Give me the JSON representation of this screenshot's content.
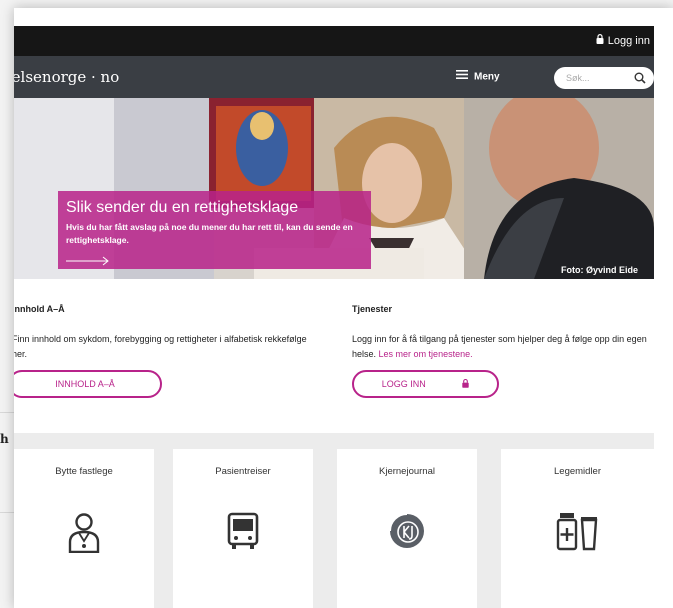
{
  "outside_fragment": "h",
  "topbar": {
    "login_label": "Logg inn"
  },
  "navbar": {
    "logo": "helsenorge · no",
    "menu_label": "Meny",
    "search_placeholder": "Søk..."
  },
  "hero": {
    "title": "Slik sender du en rettighetsklage",
    "text": "Hvis du har fått avslag på noe du mener du har rett til, kan du sende en rettighetsklage.",
    "credit": "Foto: Øyvind Eide"
  },
  "content": {
    "title": "Innhold A–Å",
    "text": "Finn innhold om sykdom, forebygging og rettigheter i alfabetisk rekkefølge her.",
    "button": "INNHOLD A–Å"
  },
  "services": {
    "title": "Tjenester",
    "text": "Logg inn for å få tilgang på tjenester som hjelper deg å følge opp din egen helse.",
    "link": "Les mer om tjenestene.",
    "button": "LOGG INN"
  },
  "cards": [
    {
      "label": "Bytte fastlege",
      "icon": "doctor-icon"
    },
    {
      "label": "Pasientreiser",
      "icon": "bus-icon"
    },
    {
      "label": "Kjernejournal",
      "icon": "kj-logo-icon"
    },
    {
      "label": "Legemidler",
      "icon": "medicine-icon"
    }
  ],
  "colors": {
    "brand": "#b8238a",
    "topbar": "#161616",
    "navbar": "#3a3e44"
  }
}
